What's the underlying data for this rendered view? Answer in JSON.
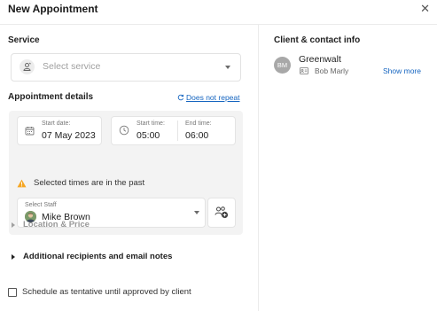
{
  "dialog": {
    "title": "New Appointment"
  },
  "service": {
    "section_label": "Service",
    "placeholder": "Select service"
  },
  "details": {
    "section_label": "Appointment details",
    "repeat_link": "Does not repeat",
    "start_date": {
      "label": "Start date:",
      "value": "07 May 2023"
    },
    "start_time": {
      "label": "Start time:",
      "value": "05:00"
    },
    "end_time": {
      "label": "End time:",
      "value": "06:00"
    },
    "warning": "Selected times are in the past",
    "staff": {
      "label": "Select Staff",
      "value": "Mike Brown"
    }
  },
  "sections": {
    "location_price": "Location & Price",
    "recipients": "Additional recipients and email notes"
  },
  "tentative": {
    "label": "Schedule as tentative until approved by client",
    "checked": false
  },
  "client": {
    "section_label": "Client & contact info",
    "initials": "BM",
    "name": "Greenwalt",
    "contact": "Bob Marly",
    "show_more": "Show more"
  },
  "icons": {
    "close": "close-icon",
    "service": "service-icon",
    "repeat": "repeat-icon",
    "calendar": "calendar-icon",
    "clock": "clock-icon",
    "warning": "warning-icon",
    "staff_avatar": "staff-avatar",
    "add_group": "add-group-icon",
    "contact_card": "contact-card-icon"
  },
  "colors": {
    "accent": "#1565c0",
    "warning": "#f5a623",
    "panel_bg": "#f3f3f3",
    "muted_text": "#999999"
  }
}
